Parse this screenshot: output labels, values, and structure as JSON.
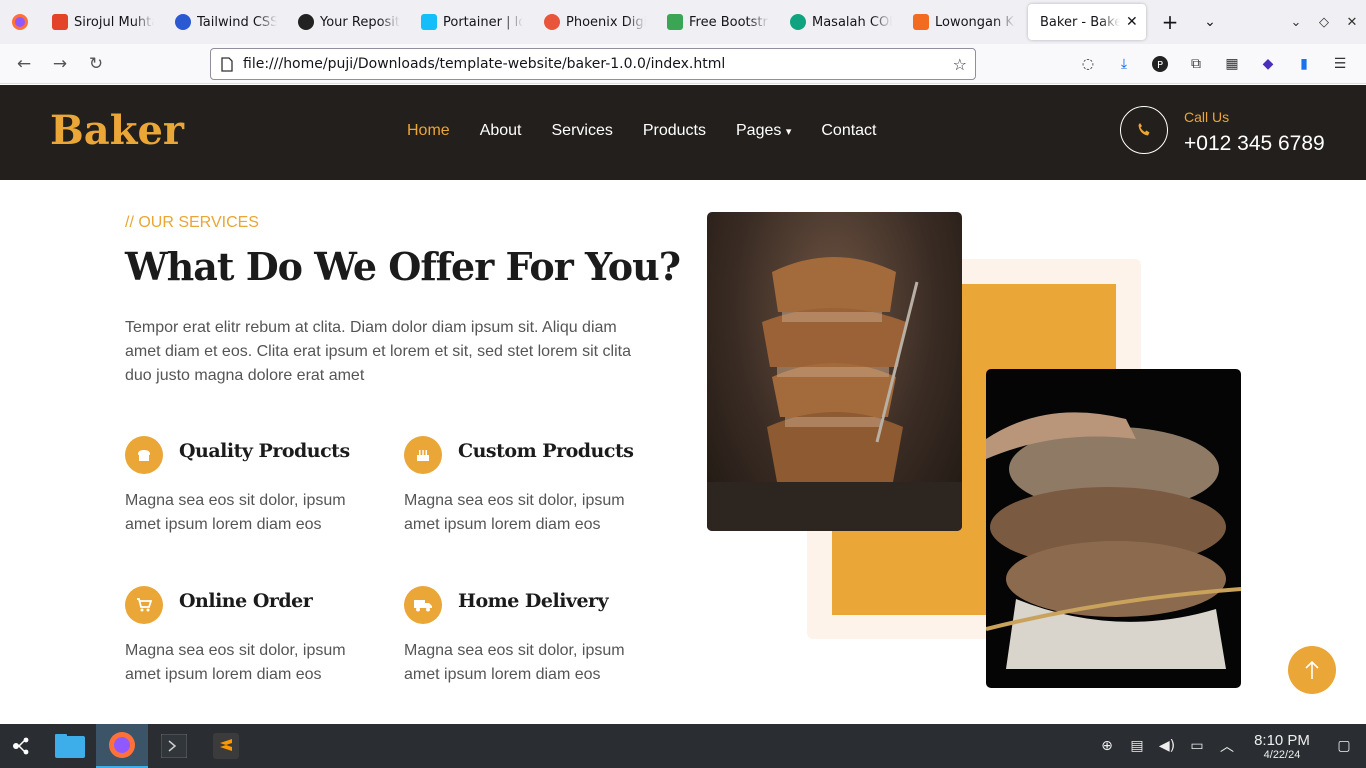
{
  "browser": {
    "tabs": [
      {
        "title": "Sirojul Muhtaj",
        "color": "#e24329"
      },
      {
        "title": "Tailwind CSS",
        "color": "#2b59d1"
      },
      {
        "title": "Your Repositories",
        "color": "#222222"
      },
      {
        "title": "Portainer | local",
        "color": "#13bef9"
      },
      {
        "title": "Phoenix Digital",
        "color": "#e8553a"
      },
      {
        "title": "Free Bootstrap",
        "color": "#3aa655"
      },
      {
        "title": "Masalah CORS",
        "color": "#10a37f"
      },
      {
        "title": "Lowongan Kerja",
        "color": "#f26b21"
      }
    ],
    "active_tab": "Baker - Bakery",
    "url": "file:///home/puji/Downloads/template-website/baker-1.0.0/index.html"
  },
  "site": {
    "logo": "Baker",
    "nav": [
      "Home",
      "About",
      "Services",
      "Products",
      "Pages",
      "Contact"
    ],
    "call_label": "Call Us",
    "phone": "+012 345 6789",
    "eyebrow": "// OUR SERVICES",
    "heading": "What Do We Offer For You?",
    "lead": "Tempor erat elitr rebum at clita. Diam dolor diam ipsum sit. Aliqu diam amet diam et eos. Clita erat ipsum et lorem et sit, sed stet lorem sit clita duo justo magna dolore erat amet",
    "features": [
      {
        "title": "Quality Products",
        "text": "Magna sea eos sit dolor, ipsum amet ipsum lorem diam eos",
        "icon": "bread-icon"
      },
      {
        "title": "Custom Products",
        "text": "Magna sea eos sit dolor, ipsum amet ipsum lorem diam eos",
        "icon": "cake-icon"
      },
      {
        "title": "Online Order",
        "text": "Magna sea eos sit dolor, ipsum amet ipsum lorem diam eos",
        "icon": "cart-icon"
      },
      {
        "title": "Home Delivery",
        "text": "Magna sea eos sit dolor, ipsum amet ipsum lorem diam eos",
        "icon": "truck-icon"
      }
    ],
    "accent": "#eaa636",
    "header_bg": "#231f1c"
  },
  "taskbar": {
    "time": "8:10 PM",
    "date": "4/22/24"
  }
}
